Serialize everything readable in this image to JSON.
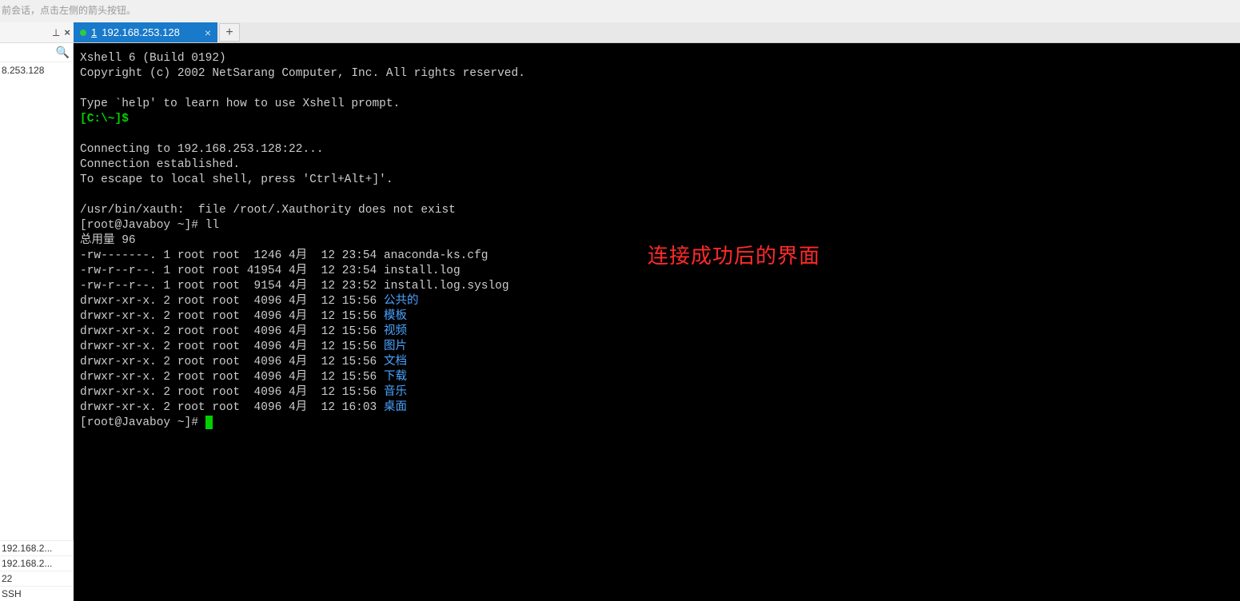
{
  "top_hint": "前会话，点击左侧的箭头按钮。",
  "sidebar": {
    "tree_item": "8.253.128",
    "bottom_rows": [
      "192.168.2...",
      "192.168.2...",
      "22",
      "SSH"
    ]
  },
  "tab": {
    "number": "1",
    "title": "192.168.253.128"
  },
  "annotation": "连接成功后的界面",
  "terminal": {
    "lines": [
      {
        "t": "plain",
        "v": "Xshell 6 (Build 0192)"
      },
      {
        "t": "plain",
        "v": "Copyright (c) 2002 NetSarang Computer, Inc. All rights reserved."
      },
      {
        "t": "blank",
        "v": ""
      },
      {
        "t": "plain",
        "v": "Type `help' to learn how to use Xshell prompt."
      },
      {
        "t": "green",
        "v": "[C:\\~]$"
      },
      {
        "t": "blank",
        "v": ""
      },
      {
        "t": "plain",
        "v": "Connecting to 192.168.253.128:22..."
      },
      {
        "t": "plain",
        "v": "Connection established."
      },
      {
        "t": "plain",
        "v": "To escape to local shell, press 'Ctrl+Alt+]'."
      },
      {
        "t": "blank",
        "v": ""
      },
      {
        "t": "plain",
        "v": "/usr/bin/xauth:  file /root/.Xauthority does not exist"
      },
      {
        "t": "plain",
        "v": "[root@Javaboy ~]# ll"
      },
      {
        "t": "plain",
        "v": "总用量 96"
      },
      {
        "t": "plain",
        "v": "-rw-------. 1 root root  1246 4月  12 23:54 anaconda-ks.cfg"
      },
      {
        "t": "plain",
        "v": "-rw-r--r--. 1 root root 41954 4月  12 23:54 install.log"
      },
      {
        "t": "plain",
        "v": "-rw-r--r--. 1 root root  9154 4月  12 23:52 install.log.syslog"
      },
      {
        "t": "dir",
        "pre": "drwxr-xr-x. 2 root root  4096 4月  12 15:56 ",
        "name": "公共的"
      },
      {
        "t": "dir",
        "pre": "drwxr-xr-x. 2 root root  4096 4月  12 15:56 ",
        "name": "模板"
      },
      {
        "t": "dir",
        "pre": "drwxr-xr-x. 2 root root  4096 4月  12 15:56 ",
        "name": "视频"
      },
      {
        "t": "dir",
        "pre": "drwxr-xr-x. 2 root root  4096 4月  12 15:56 ",
        "name": "图片"
      },
      {
        "t": "dir",
        "pre": "drwxr-xr-x. 2 root root  4096 4月  12 15:56 ",
        "name": "文档"
      },
      {
        "t": "dir",
        "pre": "drwxr-xr-x. 2 root root  4096 4月  12 15:56 ",
        "name": "下载"
      },
      {
        "t": "dir",
        "pre": "drwxr-xr-x. 2 root root  4096 4月  12 15:56 ",
        "name": "音乐"
      },
      {
        "t": "dir",
        "pre": "drwxr-xr-x. 2 root root  4096 4月  12 16:03 ",
        "name": "桌面"
      },
      {
        "t": "prompt",
        "v": "[root@Javaboy ~]# "
      }
    ]
  }
}
